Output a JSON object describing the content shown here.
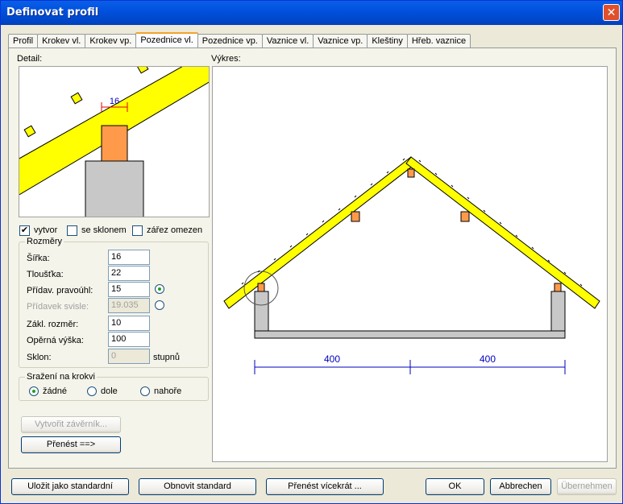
{
  "window": {
    "title": "Definovat profil",
    "close_glyph": "✕"
  },
  "tabs": [
    {
      "label": "Profil"
    },
    {
      "label": "Krokev vl."
    },
    {
      "label": "Krokev vp."
    },
    {
      "label": "Pozednice vl.",
      "active": true
    },
    {
      "label": "Pozednice vp."
    },
    {
      "label": "Vaznice vl."
    },
    {
      "label": "Vaznice vp."
    },
    {
      "label": "Kleštiny"
    },
    {
      "label": "Hřeb. vaznice"
    }
  ],
  "detail": {
    "label": "Detail:",
    "dimension": "16"
  },
  "options": {
    "vytvor": {
      "label": "vytvor",
      "checked": true
    },
    "se_sklonem": {
      "label": "se sklonem",
      "checked": false
    },
    "zarez": {
      "label": "zářez omezen",
      "checked": false
    }
  },
  "rozmery": {
    "legend": "Rozměry",
    "sirka": {
      "label": "Šířka:",
      "value": "16"
    },
    "tloustka": {
      "label": "Tloušťka:",
      "value": "22"
    },
    "pridav_pravouhl": {
      "label": "Přídav. pravoúhl:",
      "value": "15"
    },
    "pridavek_svisle": {
      "label": "Přídavek svisle:",
      "value": "19.035"
    },
    "zakl_rozmer": {
      "label": "Zákl. rozměr:",
      "value": "10"
    },
    "operna_vyska": {
      "label": "Opěrná výška:",
      "value": "100"
    },
    "sklon": {
      "label": "Sklon:",
      "value": "0",
      "unit": "stupnů"
    }
  },
  "srazeni": {
    "legend": "Sražení na krokvi",
    "options": [
      {
        "label": "žádné",
        "selected": true
      },
      {
        "label": "dole",
        "selected": false
      },
      {
        "label": "nahoře",
        "selected": false
      }
    ]
  },
  "side_buttons": {
    "vytvorit": "Vytvořit závěrník...",
    "prenest": "Přenést ==>"
  },
  "drawing": {
    "label": "Výkres:",
    "dimension_left": "400",
    "dimension_right": "400"
  },
  "footer": {
    "ulozit": "Uložit jako standardní",
    "obnovit": "Obnovit standard",
    "prenest_vicekrat": "Přenést vícekrát ...",
    "ok": "OK",
    "abbrechen": "Abbrechen",
    "ubernehmen": "Übernehmen"
  },
  "colors": {
    "rafter": "#ffff00",
    "purlin": "#ff9a4a",
    "wall": "#c8c8c8",
    "dimension": "#0000c0"
  }
}
